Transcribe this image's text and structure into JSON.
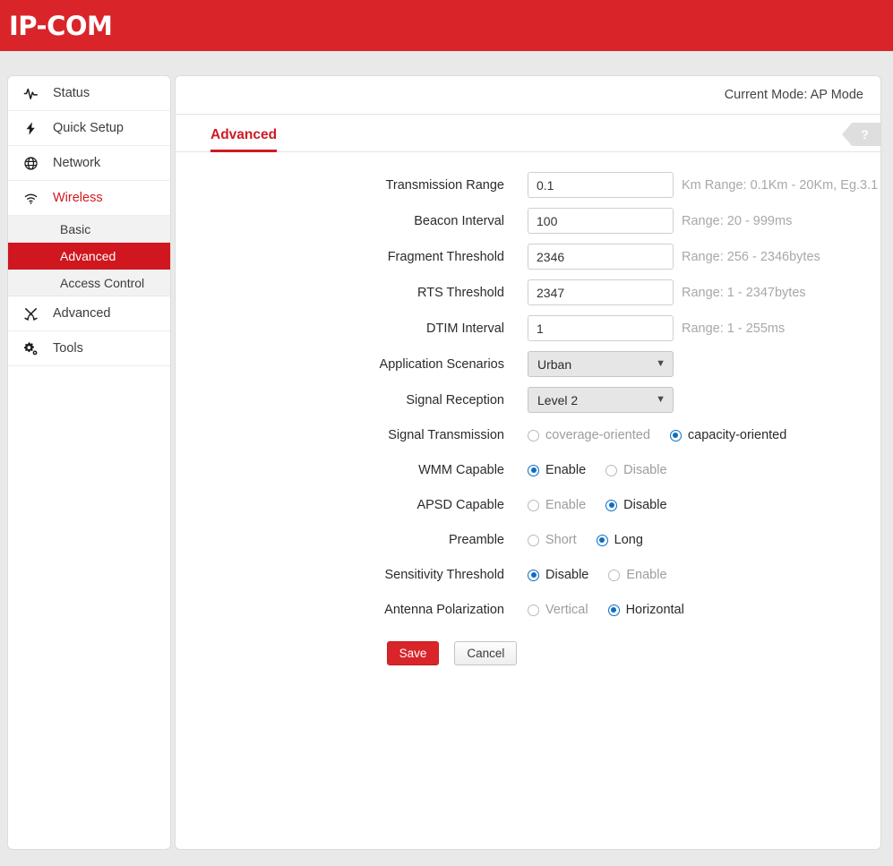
{
  "header": {
    "logo": "IP-COM"
  },
  "sidebar": {
    "items": [
      {
        "label": "Status",
        "icon": "activity-pulse-icon",
        "active": false
      },
      {
        "label": "Quick Setup",
        "icon": "lightning-bolt-icon",
        "active": false
      },
      {
        "label": "Network",
        "icon": "globe-icon",
        "active": false
      },
      {
        "label": "Wireless",
        "icon": "wifi-icon",
        "active": true
      }
    ],
    "sub_items": [
      {
        "label": "Basic",
        "active": false
      },
      {
        "label": "Advanced",
        "active": true
      },
      {
        "label": "Access Control",
        "active": false
      }
    ],
    "items_after": [
      {
        "label": "Advanced",
        "icon": "tools-cross-icon",
        "active": false
      },
      {
        "label": "Tools",
        "icon": "gears-icon",
        "active": false
      }
    ]
  },
  "main": {
    "current_mode": "Current Mode: AP Mode",
    "tab_title": "Advanced",
    "help_glyph": "?"
  },
  "form": {
    "rows": [
      {
        "label": "Transmission Range",
        "type": "text",
        "value": "0.1",
        "hint": "Km Range: 0.1Km - 20Km, Eg.3.1"
      },
      {
        "label": "Beacon Interval",
        "type": "text",
        "value": "100",
        "hint": "Range: 20 - 999ms"
      },
      {
        "label": "Fragment Threshold",
        "type": "text",
        "value": "2346",
        "hint": "Range: 256 - 2346bytes"
      },
      {
        "label": "RTS Threshold",
        "type": "text",
        "value": "2347",
        "hint": "Range: 1 - 2347bytes"
      },
      {
        "label": "DTIM Interval",
        "type": "text",
        "value": "1",
        "hint": "Range: 1 - 255ms"
      },
      {
        "label": "Application Scenarios",
        "type": "select",
        "value": "Urban",
        "hint": ""
      },
      {
        "label": "Signal Reception",
        "type": "select",
        "value": "Level 2",
        "hint": ""
      },
      {
        "label": "Signal Transmission",
        "type": "radio",
        "options": [
          {
            "label": "coverage-oriented",
            "selected": false
          },
          {
            "label": "capacity-oriented",
            "selected": true
          }
        ]
      },
      {
        "label": "WMM Capable",
        "type": "radio",
        "options": [
          {
            "label": "Enable",
            "selected": true
          },
          {
            "label": "Disable",
            "selected": false
          }
        ]
      },
      {
        "label": "APSD Capable",
        "type": "radio",
        "options": [
          {
            "label": "Enable",
            "selected": false
          },
          {
            "label": "Disable",
            "selected": true
          }
        ]
      },
      {
        "label": "Preamble",
        "type": "radio",
        "options": [
          {
            "label": "Short",
            "selected": false
          },
          {
            "label": "Long",
            "selected": true
          }
        ]
      },
      {
        "label": "Sensitivity Threshold",
        "type": "radio",
        "options": [
          {
            "label": "Disable",
            "selected": true
          },
          {
            "label": "Enable",
            "selected": false
          }
        ]
      },
      {
        "label": "Antenna Polarization",
        "type": "radio",
        "options": [
          {
            "label": "Vertical",
            "selected": false
          },
          {
            "label": "Horizontal",
            "selected": true
          }
        ]
      }
    ],
    "save_label": "Save",
    "cancel_label": "Cancel"
  },
  "colors": {
    "brand_red": "#d9252a",
    "active_red": "#d0161f",
    "link_red": "#cf1a22",
    "radio_blue": "#0b6ec4",
    "hint_gray": "#a8a8a8"
  }
}
